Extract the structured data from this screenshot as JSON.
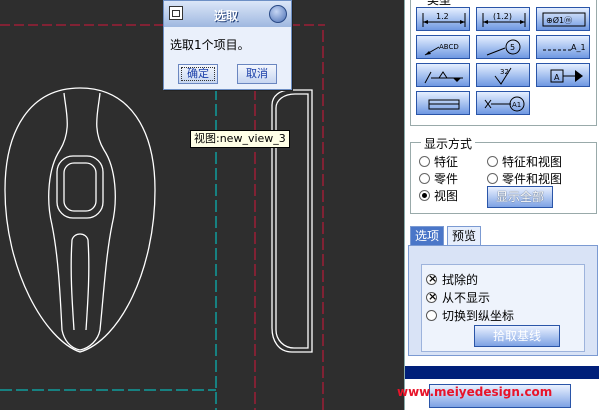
{
  "dialog": {
    "title": "选取",
    "message": "选取1个项目。",
    "ok_label": "确定",
    "cancel_label": "取消"
  },
  "tooltip": "视图:new_view_3",
  "panel": {
    "type_label": "类型",
    "symbol_buttons": [
      {
        "name": "ordinate-dimension-symbol",
        "text": "1.2"
      },
      {
        "name": "reference-dimension-symbol",
        "text": "(1.2)"
      },
      {
        "name": "geometric-tolerance-symbol",
        "text": "⊕Ø1ⓜ"
      },
      {
        "name": "note-leader-symbol",
        "text": "ABCD"
      },
      {
        "name": "balloon-symbol",
        "text": "5"
      },
      {
        "name": "datum-axis-symbol",
        "text": "A_1"
      },
      {
        "name": "weld-symbol",
        "text": ""
      },
      {
        "name": "surface-finish-symbol",
        "text": "32"
      },
      {
        "name": "datum-feature-symbol",
        "text": "A"
      },
      {
        "name": "cosmetic-feature-symbol",
        "text": ""
      },
      {
        "name": "datum-target-symbol",
        "text": "A1"
      }
    ],
    "display_mode": {
      "title": "显示方式",
      "options": [
        {
          "label": "特征",
          "selected": false
        },
        {
          "label": "特征和视图",
          "selected": false
        },
        {
          "label": "零件",
          "selected": false
        },
        {
          "label": "零件和视图",
          "selected": false
        },
        {
          "label": "视图",
          "selected": true
        }
      ],
      "show_all_label": "显示全部"
    },
    "tabs": [
      {
        "label": "选项",
        "active": true
      },
      {
        "label": "预览",
        "active": false
      }
    ],
    "options": [
      {
        "label": "拭除的",
        "checked": true
      },
      {
        "label": "从不显示",
        "checked": true
      },
      {
        "label": "切换到纵坐标",
        "checked": false
      }
    ],
    "pick_baseline_label": "拾取基线"
  },
  "watermark": "www.meiyedesign.com",
  "colors": {
    "viewport_bg": "#2e2e2e",
    "centerline_cyan": "#00d4d4",
    "centerline_red": "#d4163a",
    "geometry_white": "#ffffff",
    "panel_accent": "#4a76c8"
  }
}
